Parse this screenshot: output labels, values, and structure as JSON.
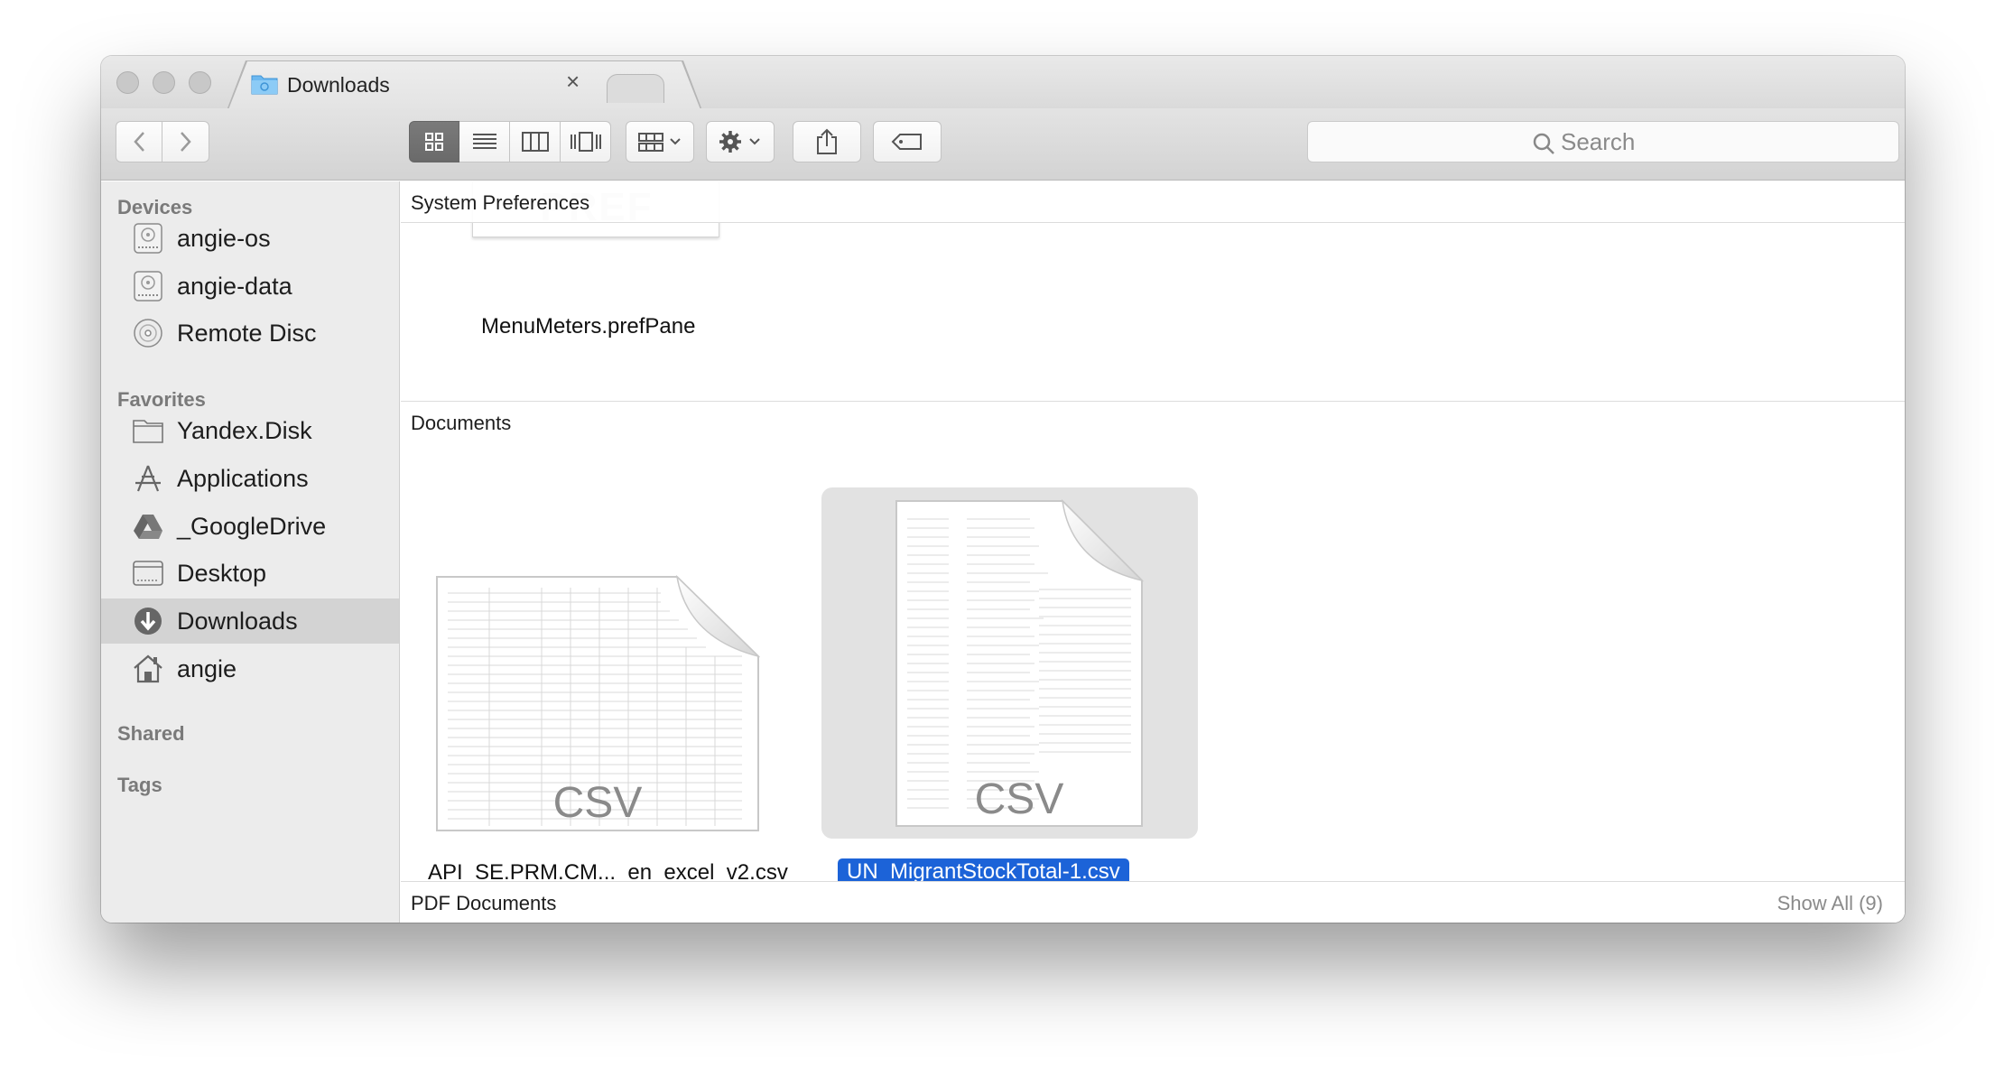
{
  "window": {
    "tab_title": "Downloads",
    "tab_close": "×"
  },
  "toolbar": {
    "back_icon": "chevron-left-icon",
    "forward_icon": "chevron-right-icon",
    "view_modes": [
      "icon-view",
      "list-view",
      "column-view",
      "cover-flow-view"
    ],
    "active_view": "icon-view",
    "search_placeholder": "Search"
  },
  "sidebar": {
    "devices_header": "Devices",
    "devices": [
      {
        "label": "angie-os",
        "icon": "hard-drive-icon"
      },
      {
        "label": "angie-data",
        "icon": "hard-drive-icon"
      },
      {
        "label": "Remote Disc",
        "icon": "disc-icon"
      }
    ],
    "favorites_header": "Favorites",
    "favorites": [
      {
        "label": "Yandex.Disk",
        "icon": "folder-icon"
      },
      {
        "label": "Applications",
        "icon": "applications-icon"
      },
      {
        "label": "_GoogleDrive",
        "icon": "google-drive-icon"
      },
      {
        "label": "Desktop",
        "icon": "desktop-icon"
      },
      {
        "label": "Downloads",
        "icon": "downloads-icon",
        "selected": true
      },
      {
        "label": "angie",
        "icon": "home-icon"
      }
    ],
    "shared_header": "Shared",
    "tags_header": "Tags"
  },
  "content": {
    "sections": [
      {
        "title": "System Preferences"
      },
      {
        "title": "Documents"
      },
      {
        "title": "PDF Documents",
        "show_all": "Show All (9)"
      }
    ],
    "pref_peek_text": "PREF",
    "files": [
      {
        "name": "MenuMeters.prefPane",
        "section": "System Preferences"
      },
      {
        "name": "API_SE.PRM.CM..._en_excel_v2.csv",
        "section": "Documents",
        "badge": "CSV"
      },
      {
        "name": "UN_MigrantStockTotal-1.csv",
        "section": "Documents",
        "badge": "CSV",
        "selected": true
      }
    ]
  }
}
